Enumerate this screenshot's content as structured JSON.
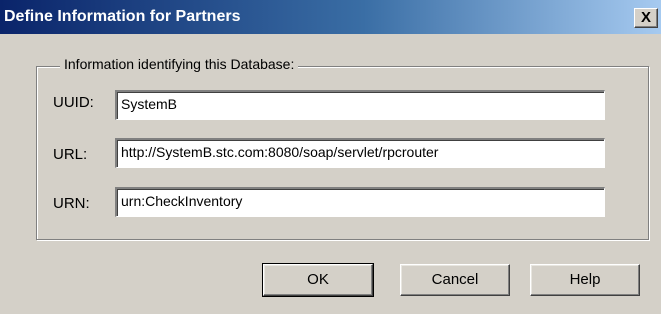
{
  "dialog": {
    "title": "Define Information for Partners",
    "close_label": "X"
  },
  "group": {
    "label": "Information identifying this Database:"
  },
  "fields": {
    "uuid": {
      "label": "UUID:",
      "value": "SystemB"
    },
    "url": {
      "label": "URL:",
      "value": "http://SystemB.stc.com:8080/soap/servlet/rpcrouter"
    },
    "urn": {
      "label": "URN:",
      "value": "urn:CheckInventory"
    }
  },
  "buttons": {
    "ok": "OK",
    "cancel": "Cancel",
    "help": "Help"
  },
  "colors": {
    "titlebar_start": "#0a246a",
    "titlebar_end": "#a6caf0",
    "window_bg": "#d4d0c8"
  }
}
